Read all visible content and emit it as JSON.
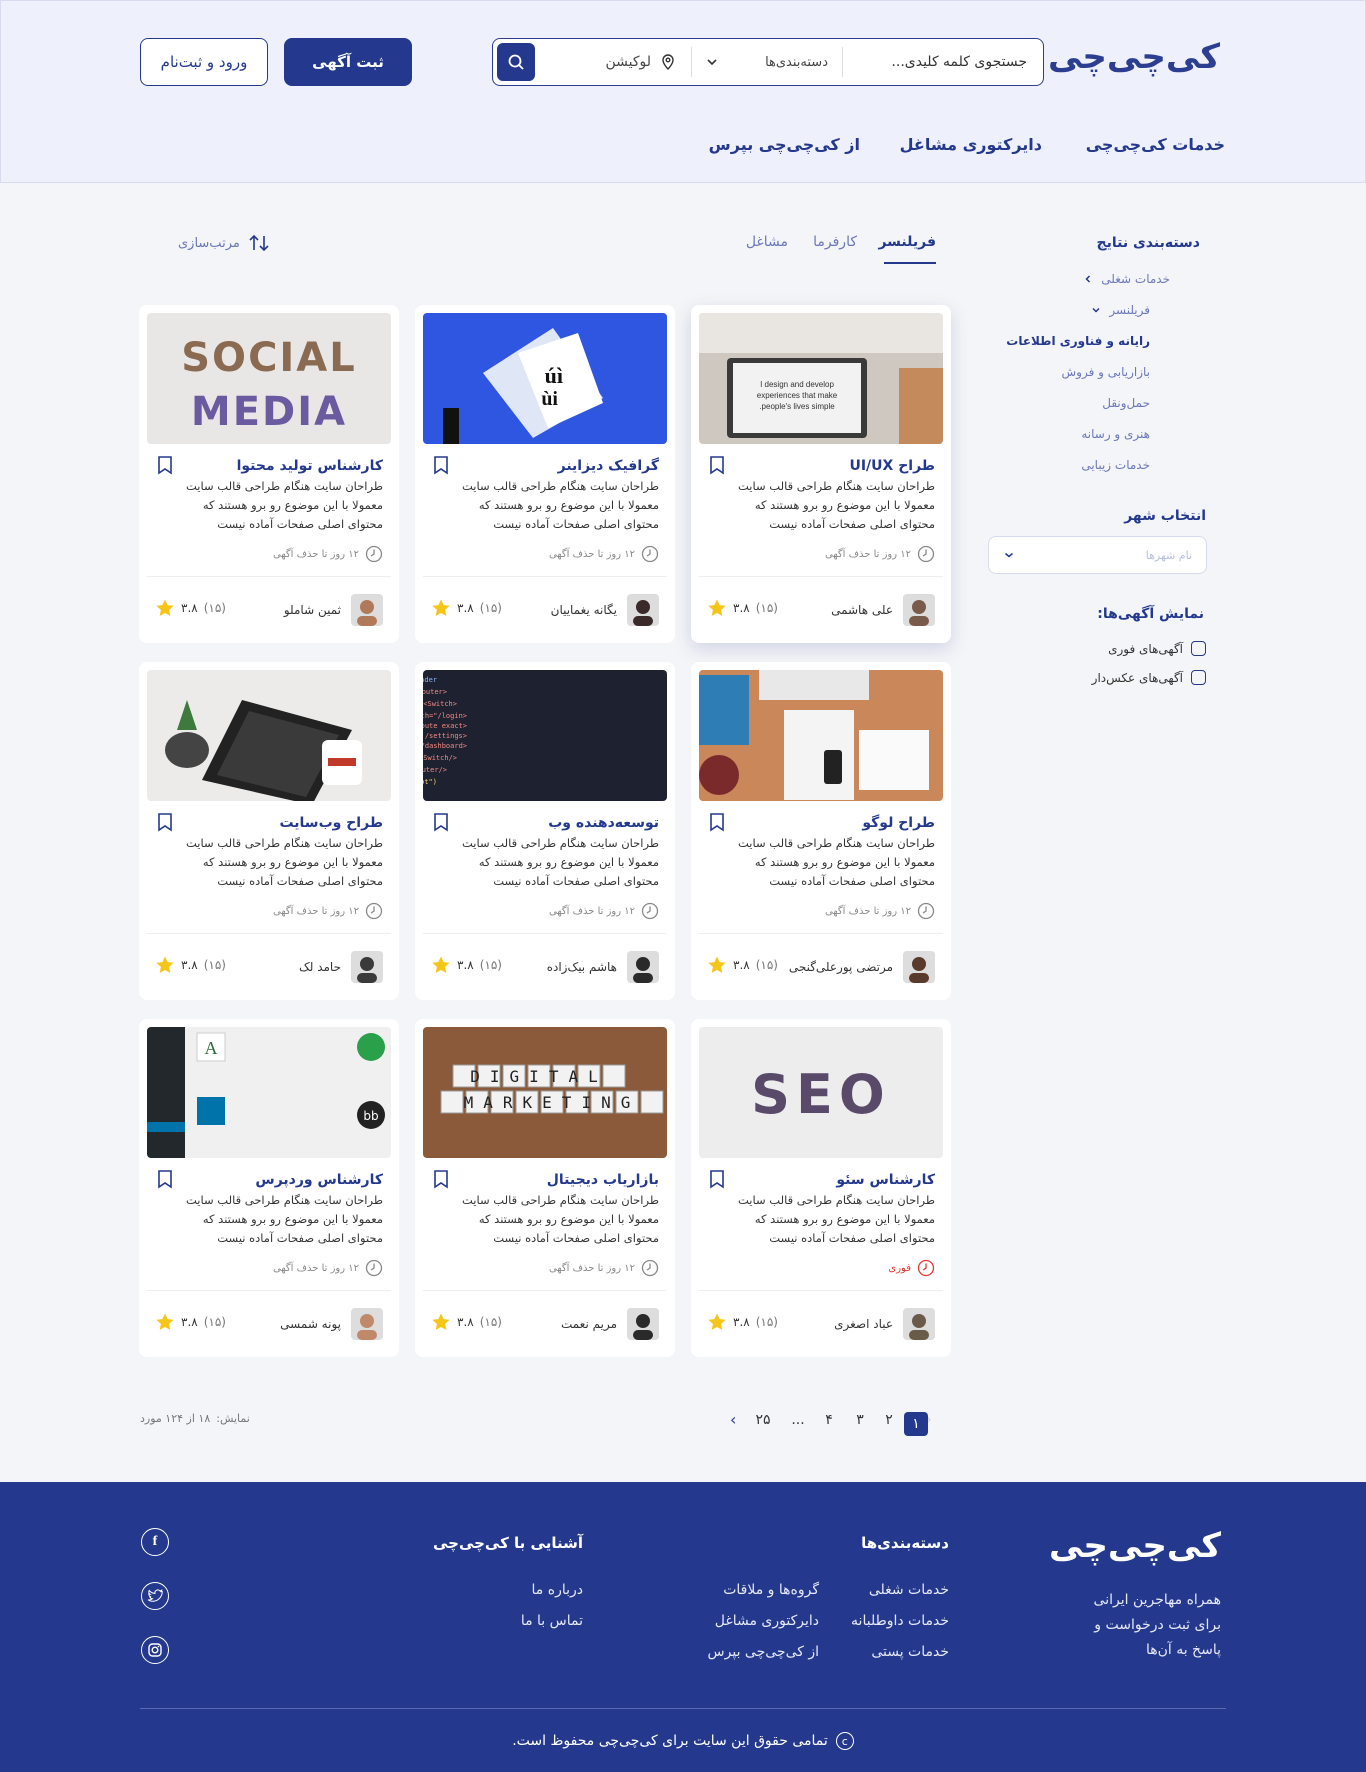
{
  "brand": {
    "name": "کی‌چی‌چی"
  },
  "header": {
    "search_keyword": "جستجوی کلمه کلیدی...",
    "category_label": "دسته‌بندی‌ها",
    "location_label": "لوکیشن",
    "post_ad": "ثبت آگهی",
    "login": "ورود و ثبت‌نام",
    "nav": [
      "خدمات کی‌چی‌چی",
      "دایرکتوری مشاغل",
      "از کی‌چی‌چی بپرس"
    ]
  },
  "sidebar": {
    "categories_title": "دسته‌بندی نتایج",
    "categories": [
      "خدمات شغلی",
      "فریلنسر",
      "رایانه و فناوری اطلاعات",
      "بازاریابی و فروش",
      "حمل‌ونقل",
      "هنری و رسانه",
      "خدمات زیبایی"
    ],
    "city_title": "انتخاب شهر",
    "city_placeholder": "نام شهرها",
    "show_title": "نمایش آگهی‌ها:",
    "show_options": [
      "آگهی‌های فوری",
      "آگهی‌های عکس‌دار"
    ]
  },
  "tabs": {
    "items": [
      "فریلنسر",
      "کارفرما",
      "مشاغل"
    ],
    "active": "فریلنسر",
    "sort_label": "مرتب‌سازی"
  },
  "cards": [
    {
      "title": "طراح UI/UX",
      "desc": "طراحان سایت هنگام طراحی قالب سایت معمولا با این موضوع رو برو هستند که محتوای اصلی صفحات آماده نیست",
      "deadline": "۱۲ روز تا حذف آگهی",
      "user": "علی هاشمی",
      "rating": "۳.۸",
      "count": "(۱۵)",
      "image": "laptop-photo"
    },
    {
      "title": "گرافیک دیزاینر",
      "desc": "طراحان سایت هنگام طراحی قالب سایت معمولا با این موضوع رو برو هستند که محتوای اصلی صفحات آماده نیست",
      "deadline": "۱۲ روز تا حذف آگهی",
      "user": "یگانه یغماییان",
      "rating": "۳.۸",
      "count": "(۱۵)",
      "image": "typography-photo"
    },
    {
      "title": "کارشناس تولید محتوا",
      "desc": "طراحان سایت هنگام طراحی قالب سایت معمولا با این موضوع رو برو هستند که محتوای اصلی صفحات آماده نیست",
      "deadline": "۱۲ روز تا حذف آگهی",
      "user": "ثمین شاملو",
      "rating": "۳.۸",
      "count": "(۱۵)",
      "image": "social-media-photo"
    },
    {
      "title": "طراح لوگو",
      "desc": "طراحان سایت هنگام طراحی قالب سایت معمولا با این موضوع رو برو هستند که محتوای اصلی صفحات آماده نیست",
      "deadline": "۱۲ روز تا حذف آگهی",
      "user": "مرتضی پورعلی‌گنجی",
      "rating": "۳.۸",
      "count": "(۱۵)",
      "image": "desk-photo"
    },
    {
      "title": "توسعه‌دهنده وب",
      "desc": "طراحان سایت هنگام طراحی قالب سایت معمولا با این موضوع رو برو هستند که محتوای اصلی صفحات آماده نیست",
      "deadline": "۱۲ روز تا حذف آگهی",
      "user": "هاشم بیک‌زاده",
      "rating": "۳.۸",
      "count": "(۱۵)",
      "image": "code-photo"
    },
    {
      "title": "طراح وب‌سایت",
      "desc": "طراحان سایت هنگام طراحی قالب سایت معمولا با این موضوع رو برو هستند که محتوای اصلی صفحات آماده نیست",
      "deadline": "۱۲ روز تا حذف آگهی",
      "user": "حامد لک",
      "rating": "۳.۸",
      "count": "(۱۵)",
      "image": "tablet-photo"
    },
    {
      "title": "کارشناس سئو",
      "desc": "طراحان سایت هنگام طراحی قالب سایت معمولا با این موضوع رو برو هستند که محتوای اصلی صفحات آماده نیست",
      "deadline": "فوری",
      "user": "عباد اصغری",
      "rating": "۳.۸",
      "count": "(۱۵)",
      "image": "seo-photo",
      "urgent": true
    },
    {
      "title": "بازاریاب دیجیتال",
      "desc": "طراحان سایت هنگام طراحی قالب سایت معمولا با این موضوع رو برو هستند که محتوای اصلی صفحات آماده نیست",
      "deadline": "۱۲ روز تا حذف آگهی",
      "user": "مریم نعمت",
      "rating": "۳.۸",
      "count": "(۱۵)",
      "image": "digital-marketing-photo"
    },
    {
      "title": "کارشناس وردپرس",
      "desc": "طراحان سایت هنگام طراحی قالب سایت معمولا با این موضوع رو برو هستند که محتوای اصلی صفحات آماده نیست",
      "deadline": "۱۲ روز تا حذف آگهی",
      "user": "پونه شمسی",
      "rating": "۳.۸",
      "count": "(۱۵)",
      "image": "wordpress-photo"
    }
  ],
  "pagination": {
    "pages": [
      "۱",
      "۲",
      "۳",
      "۴",
      "...",
      "۲۵"
    ],
    "current": "۱",
    "summary_label": "نمایش:",
    "summary": "۱۸ از ۱۲۴ مورد"
  },
  "footer": {
    "tagline": [
      "همراه مهاجرین ایرانی",
      "برای ثبت درخواست و",
      "پاسخ به آن‌ها"
    ],
    "categories_title": "دسته‌بندی‌ها",
    "col1": [
      "خدمات شغلی",
      "خدمات داوطلبانه",
      "خدمات پستی"
    ],
    "col2": [
      "گروه‌ها و ملاقات",
      "دایرکتوری مشاغل",
      "از کی‌چی‌چی بپرس"
    ],
    "about_title": "آشنایی با کی‌چی‌چی",
    "about": [
      "درباره ما",
      "تماس با ما"
    ],
    "copyright": "تمامی حقوق این سایت برای کی‌چی‌چی محفوظ است."
  },
  "colors": {
    "primary": "#24398d",
    "star": "#f5c518",
    "urgent": "#e53935"
  }
}
